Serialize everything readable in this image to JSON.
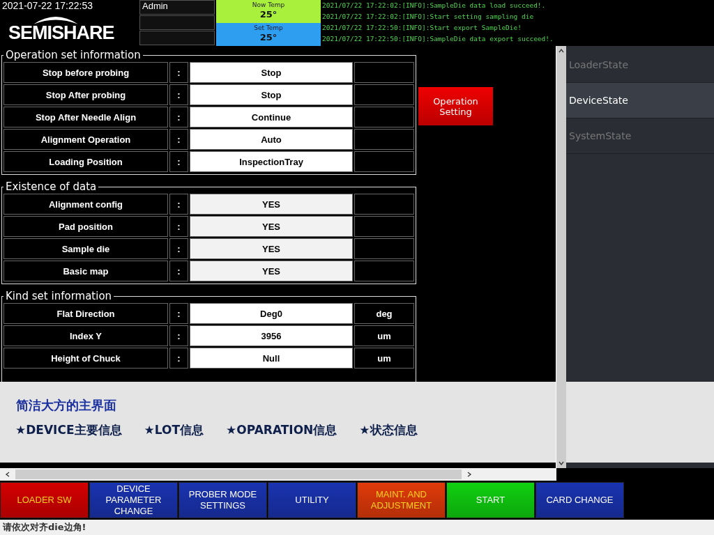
{
  "header": {
    "datetime": "2021-07-22 17:22:53",
    "logo": "SEMISHARE",
    "user_fields": [
      "Admin"
    ],
    "now_temp": {
      "label": "Now Temp",
      "value": "25°"
    },
    "set_temp": {
      "label": "Set Temp",
      "value": "25°"
    },
    "log": [
      "2021/07/22 17:22:02:[INFO]:SampleDie data load succeed!.",
      "2021/07/22 17:22:02:[INFO]:Start setting sampling die",
      "2021/07/22 17:22:50:[INFO]:Start export SampleDie!",
      "2021/07/22 17:22:50:[INFO]:SampleDie data export succeed!."
    ]
  },
  "groups": [
    {
      "title": "Operation set information",
      "editable": true,
      "rows": [
        {
          "label": "Stop before probing",
          "sep": ":",
          "value": "Stop"
        },
        {
          "label": "Stop After probing",
          "sep": ":",
          "value": "Stop"
        },
        {
          "label": "Stop After Needle Align",
          "sep": ":",
          "value": "Continue"
        },
        {
          "label": "Alignment Operation",
          "sep": ":",
          "value": "Auto"
        },
        {
          "label": "Loading Position",
          "sep": ":",
          "value": "InspectionTray"
        }
      ]
    },
    {
      "title": "Existence of data",
      "editable": false,
      "rows": [
        {
          "label": "Alignment config",
          "sep": ":",
          "value": "YES"
        },
        {
          "label": "Pad position",
          "sep": ":",
          "value": "YES"
        },
        {
          "label": "Sample die",
          "sep": ":",
          "value": "YES"
        },
        {
          "label": "Basic map",
          "sep": ":",
          "value": "YES"
        }
      ]
    },
    {
      "title": "Kind set information",
      "editable": true,
      "rows": [
        {
          "label": "Flat Direction",
          "sep": ":",
          "value": "Deg0",
          "unit": "deg"
        },
        {
          "label": "Index Y",
          "sep": ":",
          "value": "3956",
          "unit": "um"
        },
        {
          "label": "Height of Chuck",
          "sep": ":",
          "value": "Null",
          "unit": "um"
        }
      ]
    }
  ],
  "operation_button": "Operation Setting",
  "sidebar": [
    {
      "label": "LoaderState",
      "selected": false
    },
    {
      "label": "DeviceState",
      "selected": true
    },
    {
      "label": "SystemState",
      "selected": false
    }
  ],
  "overlay": {
    "title": "简洁大方的主界面",
    "items": [
      "★DEVICE主要信息",
      "★LOT信息",
      "★OPARATION信息",
      "★状态信息"
    ]
  },
  "buttons": [
    {
      "label": "LOADER SW",
      "color": "#d40000"
    },
    {
      "label": "DEVICE PARAMETER CHANGE",
      "color": "#1a33b0"
    },
    {
      "label": "PROBER MODE SETTINGS",
      "color": "#1a33b0"
    },
    {
      "label": "UTILITY",
      "color": "#1a33b0"
    },
    {
      "label": "MAINT. AND ADJUSTMENT",
      "color": "#e03a0a"
    },
    {
      "label": "START",
      "color": "#10d010"
    },
    {
      "label": "CARD CHANGE",
      "color": "#1a33b0"
    }
  ],
  "status": "请依次对齐die边角!"
}
